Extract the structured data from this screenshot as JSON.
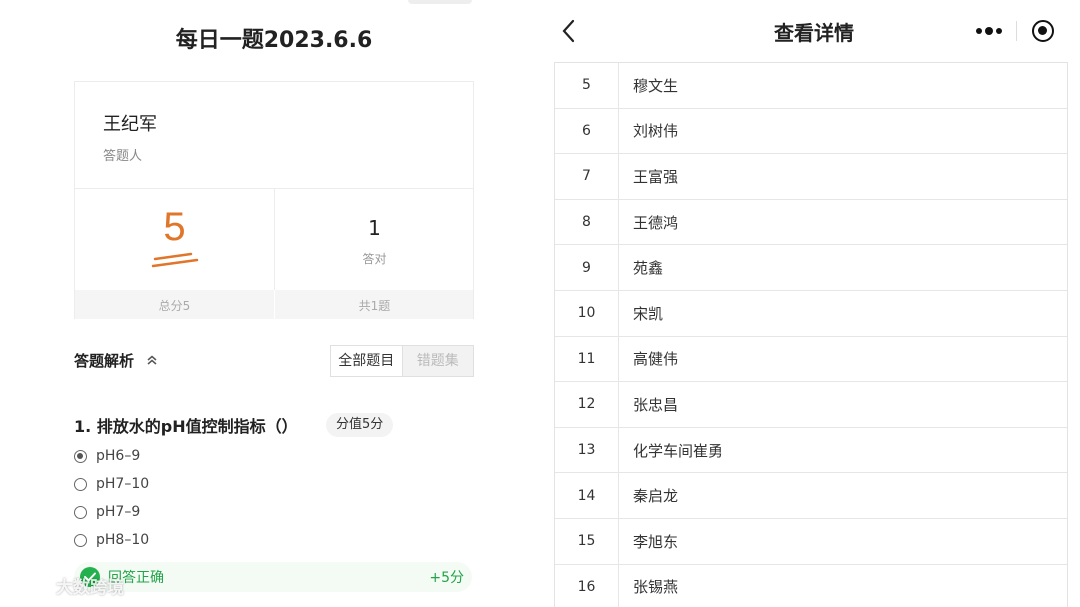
{
  "left": {
    "title": "每日一题2023.6.6",
    "answerer": {
      "name": "王纪军",
      "label": "答题人"
    },
    "score": {
      "value": "5",
      "total_label": "总分5"
    },
    "correct": {
      "count": "1",
      "label": "答对",
      "total_label": "共1题"
    },
    "analysis": {
      "title": "答题解析",
      "tabs": [
        {
          "label": "全部题目"
        },
        {
          "label": "错题集"
        }
      ]
    },
    "question": {
      "text": "1. 排放水的pH值控制指标（）",
      "score_pill": "分值5分",
      "options": [
        {
          "label": "pH6–9",
          "checked": true
        },
        {
          "label": "pH7–10",
          "checked": false
        },
        {
          "label": "pH7–9",
          "checked": false
        },
        {
          "label": "pH8–10",
          "checked": false
        }
      ],
      "result": {
        "text": "回答正确",
        "points": "+5分"
      }
    },
    "watermark": "大数跨境"
  },
  "right": {
    "nav": {
      "title": "查看详情"
    },
    "rows": [
      {
        "no": "5",
        "name": "穆文生"
      },
      {
        "no": "6",
        "name": "刘树伟"
      },
      {
        "no": "7",
        "name": "王富强"
      },
      {
        "no": "8",
        "name": "王德鸿"
      },
      {
        "no": "9",
        "name": "苑鑫"
      },
      {
        "no": "10",
        "name": "宋凯"
      },
      {
        "no": "11",
        "name": "高健伟"
      },
      {
        "no": "12",
        "name": "张忠昌"
      },
      {
        "no": "13",
        "name": "化学车间崔勇"
      },
      {
        "no": "14",
        "name": "秦启龙"
      },
      {
        "no": "15",
        "name": "李旭东"
      },
      {
        "no": "16",
        "name": "张锡燕"
      }
    ]
  },
  "colors": {
    "score_orange": "#e0762a",
    "success_green": "#22b14c"
  }
}
